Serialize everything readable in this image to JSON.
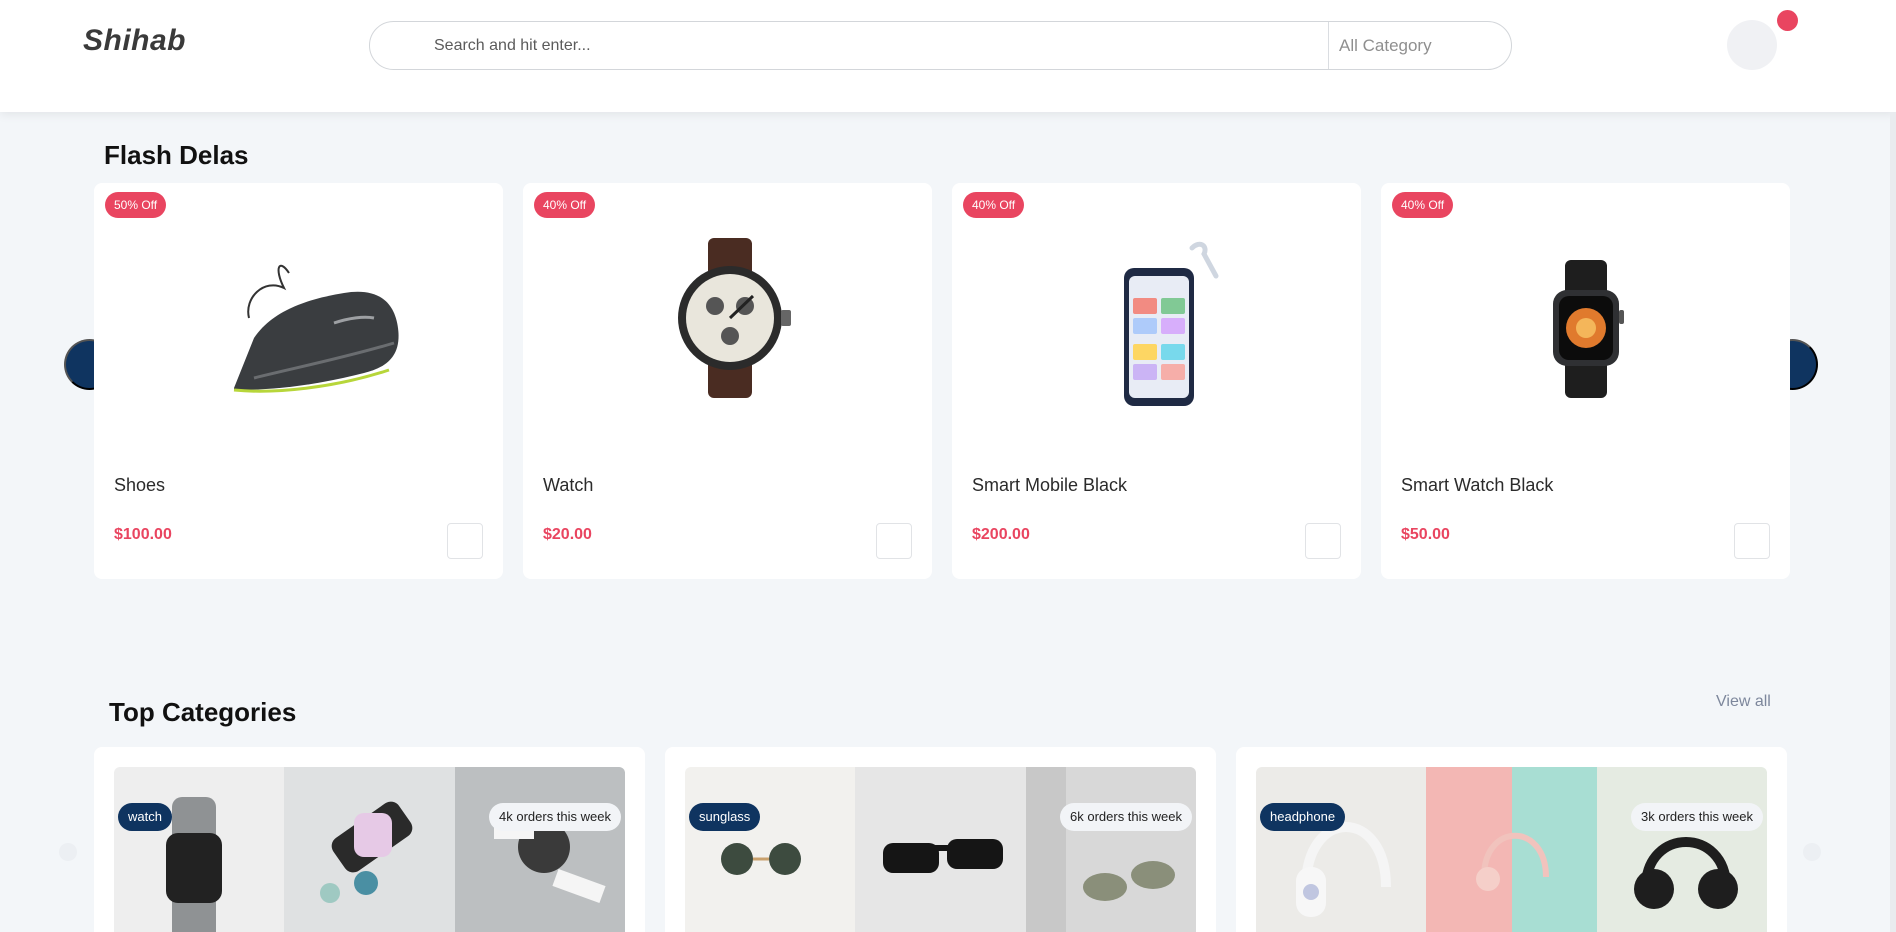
{
  "header": {
    "logo": "Shihab",
    "search_placeholder": "Search and hit enter...",
    "category_label": "All Category"
  },
  "flash_deals": {
    "title": "Flash Delas",
    "products": [
      {
        "discount": "50% Off",
        "name": "Shoes",
        "price": "$100.00",
        "icon": "shoe-image"
      },
      {
        "discount": "40% Off",
        "name": "Watch",
        "price": "$20.00",
        "icon": "watch-image"
      },
      {
        "discount": "40% Off",
        "name": "Smart Mobile Black",
        "price": "$200.00",
        "icon": "smartphone-image"
      },
      {
        "discount": "40% Off",
        "name": "Smart Watch Black",
        "price": "$50.00",
        "icon": "smartwatch-image"
      }
    ]
  },
  "top_categories": {
    "title": "Top Categories",
    "view_all": "View all",
    "categories": [
      {
        "tag": "watch",
        "orders": "4k orders this week"
      },
      {
        "tag": "sunglass",
        "orders": "6k orders this week"
      },
      {
        "tag": "headphone",
        "orders": "3k orders this week"
      }
    ]
  },
  "colors": {
    "accent": "#e94560",
    "navy": "#0f3460",
    "page_bg": "#f3f6f9"
  }
}
